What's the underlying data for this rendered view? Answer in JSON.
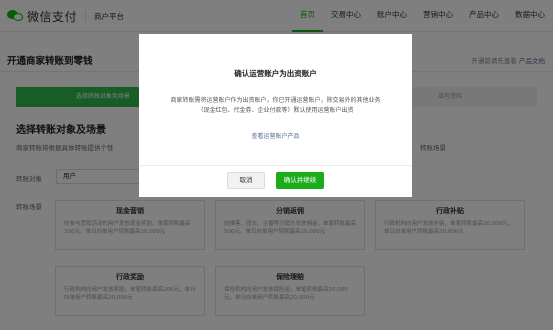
{
  "brand": {
    "name": "微信支付",
    "subtitle": "商户平台"
  },
  "nav": [
    "首页",
    "交易中心",
    "账户中心",
    "营销中心",
    "产品中心",
    "数据中心"
  ],
  "page": {
    "title": "开通商家转账到零钱",
    "top_right_text": "开通前请先查看",
    "top_right_link": "产品文档"
  },
  "steps": [
    "选择转账对象及场景",
    "",
    "填写资料"
  ],
  "section": {
    "title": "选择转账对象及场景",
    "desc_left": "商家转账将根据具体转账提供个性",
    "desc_right": "转账场景"
  },
  "form": {
    "object_label": "转账对象",
    "object_value": "用户",
    "scene_label": "转账场景"
  },
  "cards": [
    {
      "title": "现金营销",
      "desc": "向参与营销活动的用户发放现金奖励，单笔转账最高200元，单日向单用户转账最高20,000元"
    },
    {
      "title": "分销返佣",
      "desc": "向推客、团长、主播等分销方发放佣金，单笔转账最高500元，单日向单用户转账最高20,000元"
    },
    {
      "title": "行政补贴",
      "desc": "行政机构向用户发放补贴，单笔转账最高20,000元，单日向单用户转账最高20,000元"
    },
    {
      "title": "行政奖励",
      "desc": "行政机构向用户发放奖励，单笔转账最高200元，单日向单用户转账最高20,000元"
    },
    {
      "title": "保险理赔",
      "desc": "保险机构向用户发放保险金，单笔转账最高20,000元，单日向单用户转账最高20,000元"
    }
  ],
  "modal": {
    "title": "确认运营账户为出资账户",
    "body_line1": "商家转账需将运营账户作为出资账户，你已开通运营账户，除交易外的其他业务",
    "body_line2": "（现金红包、代金券、企业付款等）默认使用运营账户出资",
    "link": "查看运营账户产品",
    "cancel": "取消",
    "confirm": "确认并继续"
  },
  "colors": {
    "brand_green": "#1aad19",
    "link_blue": "#576b95",
    "step_active": "#2fba4a"
  }
}
